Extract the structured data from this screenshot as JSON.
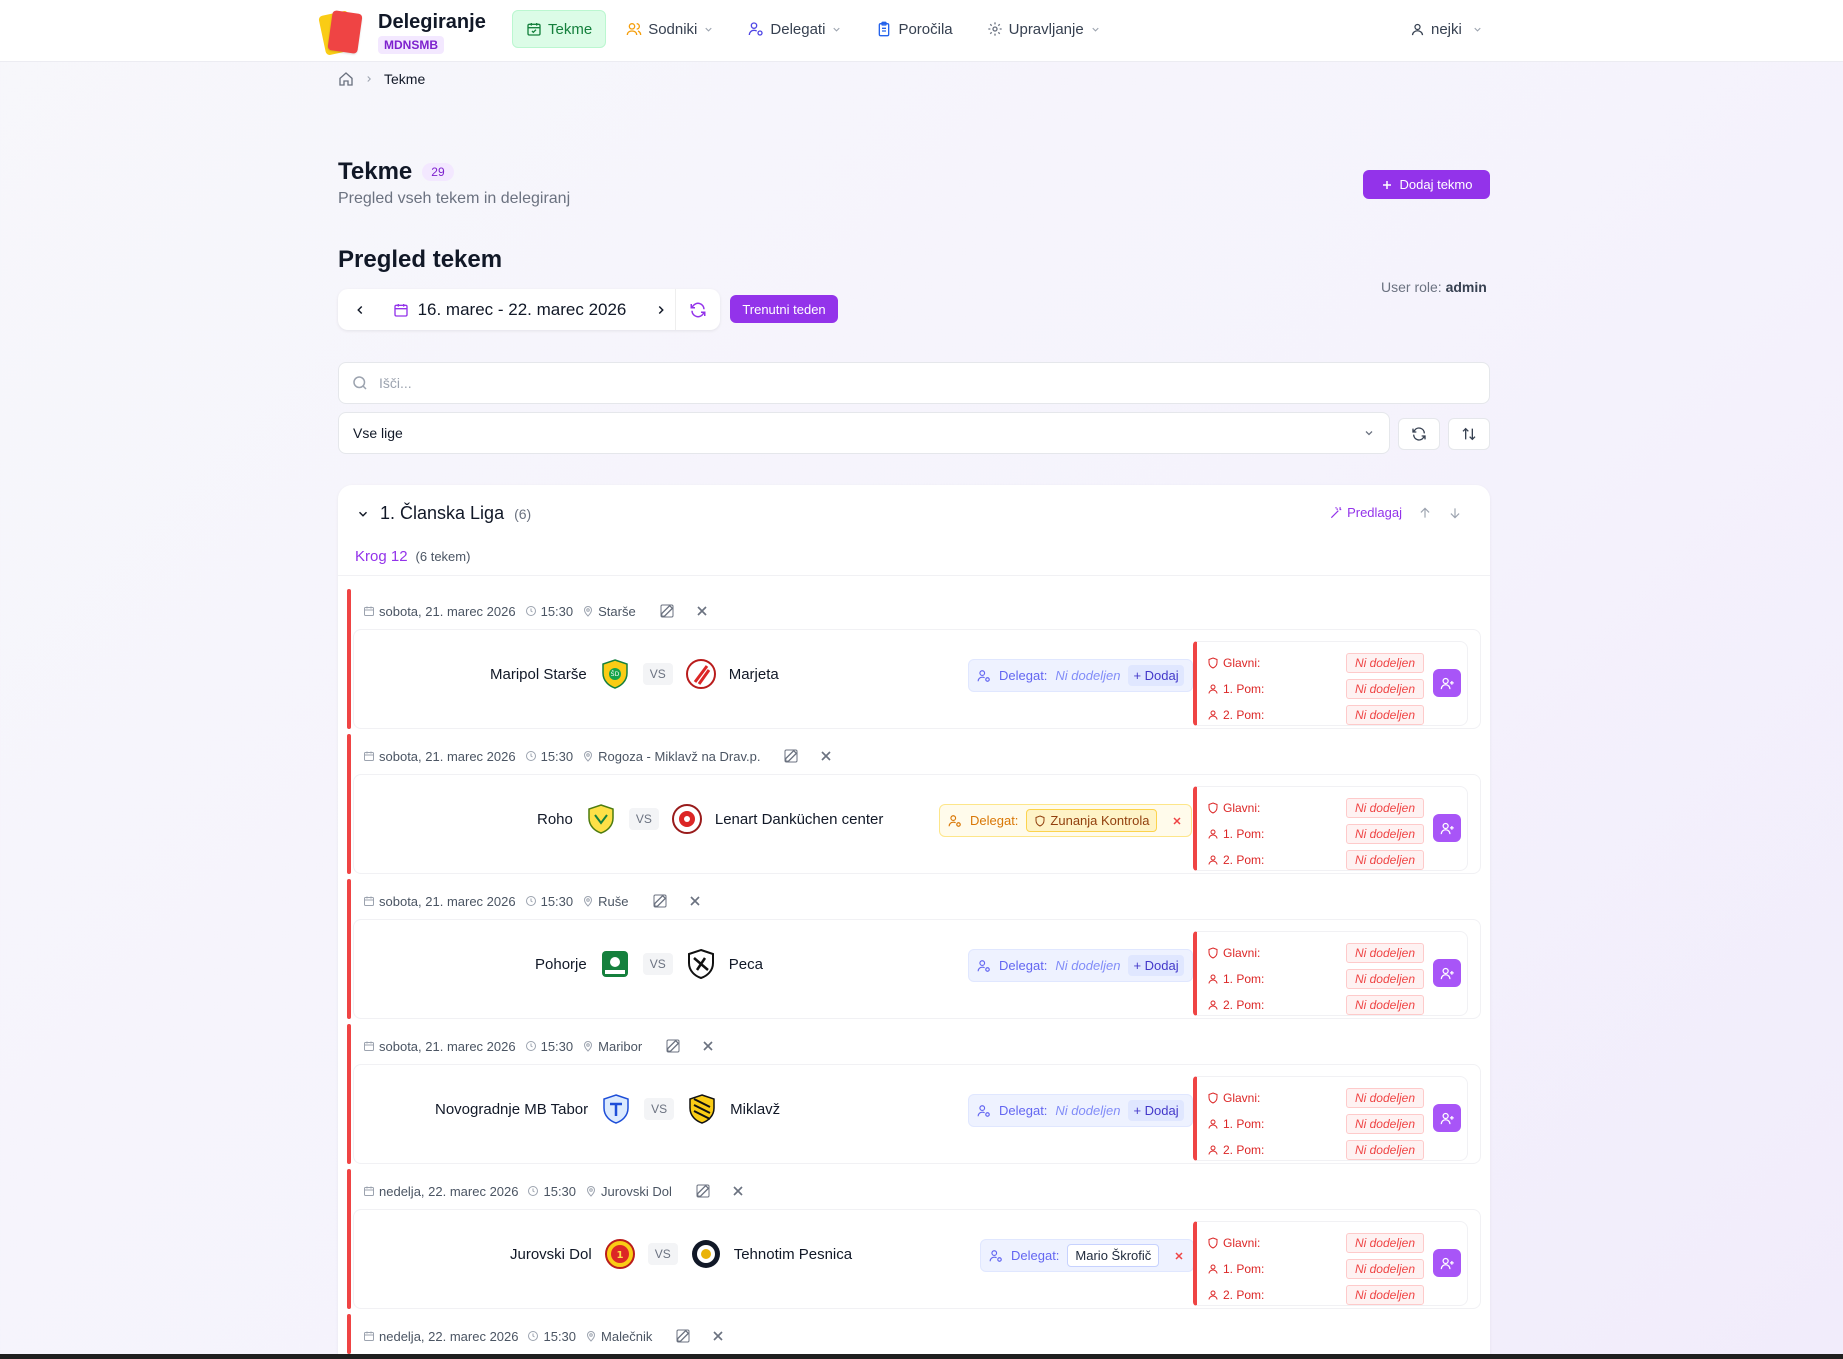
{
  "brand": {
    "title": "Delegiranje",
    "badge": "MDNSMB"
  },
  "nav": {
    "items": [
      {
        "label": "Tekme",
        "icon": "calendar-icon",
        "active": true,
        "dropdown": false
      },
      {
        "label": "Sodniki",
        "icon": "users-icon",
        "active": false,
        "dropdown": true
      },
      {
        "label": "Delegati",
        "icon": "user-cog-icon",
        "active": false,
        "dropdown": true
      },
      {
        "label": "Poročila",
        "icon": "clipboard-icon",
        "active": false,
        "dropdown": false
      },
      {
        "label": "Upravljanje",
        "icon": "gear-icon",
        "active": false,
        "dropdown": true
      }
    ],
    "user": "nejki"
  },
  "breadcrumb": {
    "current": "Tekme"
  },
  "page": {
    "title": "Tekme",
    "count": "29",
    "subtitle": "Pregled vseh tekem in delegiranj",
    "add_button": "Dodaj tekmo",
    "section_title": "Pregled tekem",
    "week_range": "16. marec - 22. marec 2026",
    "current_week_button": "Trenutni teden",
    "user_role_label": "User role:",
    "user_role_value": "admin"
  },
  "filters": {
    "search_placeholder": "Išči...",
    "league_select": "Vse lige"
  },
  "league": {
    "name": "1. Članska Liga",
    "count": "(6)",
    "suggest_label": "Predlagaj",
    "round_name": "Krog 12",
    "round_count": "(6 tekem)"
  },
  "ref_labels": {
    "main": "Glavni:",
    "asst1": "1. Pom:",
    "asst2": "2. Pom:"
  },
  "delegate_label": "Delegat:",
  "add_label": "+ Dodaj",
  "unassigned": "Ni dodeljen",
  "matches": [
    {
      "date": "sobota, 21. marec 2026",
      "time": "15:30",
      "venue": "Starše",
      "home": "Maripol Starše",
      "away": "Marjeta",
      "delegate": "Ni dodeljen",
      "delegate_status": "empty"
    },
    {
      "date": "sobota, 21. marec 2026",
      "time": "15:30",
      "venue": "Rogoza - Miklavž na Drav.p.",
      "home": "Roho",
      "away": "Lenart Danküchen center",
      "delegate": "Zunanja Kontrola",
      "delegate_status": "external"
    },
    {
      "date": "sobota, 21. marec 2026",
      "time": "15:30",
      "venue": "Ruše",
      "home": "Pohorje",
      "away": "Peca",
      "delegate": "Ni dodeljen",
      "delegate_status": "empty"
    },
    {
      "date": "sobota, 21. marec 2026",
      "time": "15:30",
      "venue": "Maribor",
      "home": "Novogradnje MB Tabor",
      "away": "Miklavž",
      "delegate": "Ni dodeljen",
      "delegate_status": "empty"
    },
    {
      "date": "nedelja, 22. marec 2026",
      "time": "15:30",
      "venue": "Jurovski Dol",
      "home": "Jurovski Dol",
      "away": "Tehnotim Pesnica",
      "delegate": "Mario Škrofič",
      "delegate_status": "assigned"
    },
    {
      "date": "nedelja, 22. marec 2026",
      "time": "15:30",
      "venue": "Malečnik"
    }
  ],
  "colors": {
    "accent": "#9333ea",
    "active_nav": "#15803d",
    "status_red": "#ef4444",
    "delegate_blue": "#6366f1",
    "external_amber": "#d97706"
  }
}
